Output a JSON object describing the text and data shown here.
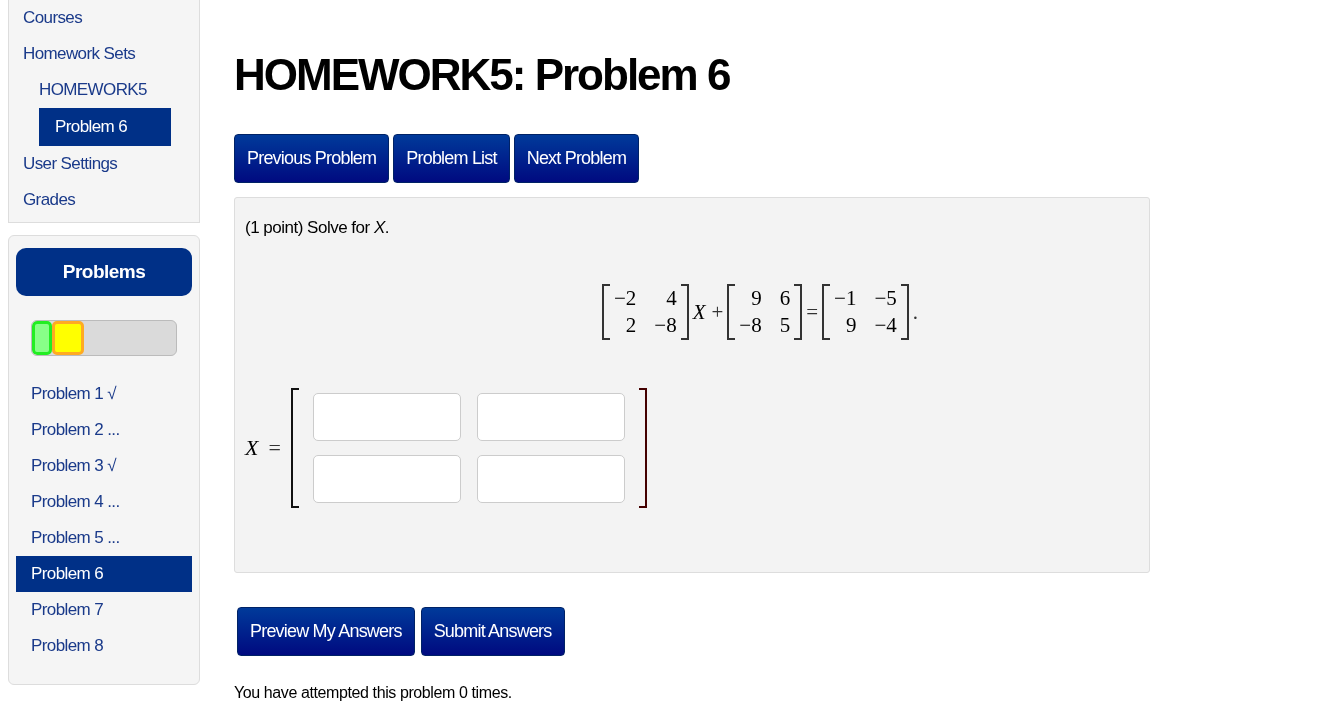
{
  "nav": {
    "items": [
      {
        "label": "Courses",
        "selected": false
      },
      {
        "label": "Homework Sets",
        "selected": false,
        "children": [
          {
            "label": "HOMEWORK5",
            "selected": false,
            "children": [
              {
                "label": "Problem 6",
                "selected": true
              }
            ]
          }
        ]
      },
      {
        "label": "User Settings",
        "selected": false
      },
      {
        "label": "Grades",
        "selected": false
      }
    ]
  },
  "problems_panel": {
    "title": "Problems",
    "progress": [
      {
        "color": "#88ff88",
        "level": 0.14
      },
      {
        "color": "#ffff00",
        "level": 0.22
      }
    ],
    "items": [
      {
        "label": "Problem 1 √",
        "selected": false
      },
      {
        "label": "Problem 2 ...",
        "selected": false
      },
      {
        "label": "Problem 3 √",
        "selected": false
      },
      {
        "label": "Problem 4 ...",
        "selected": false
      },
      {
        "label": "Problem 5 ...",
        "selected": false
      },
      {
        "label": "Problem 6",
        "selected": true
      },
      {
        "label": "Problem 7",
        "selected": false
      },
      {
        "label": "Problem 8",
        "selected": false
      }
    ]
  },
  "title": "HOMEWORK5: Problem 6",
  "nav_buttons": [
    "Previous Problem",
    "Problem List",
    "Next Problem"
  ],
  "problem": {
    "prompt": "(1 point) Solve for *X*.",
    "equation": [
      {
        "kind": "matrix",
        "rows": [
          [
            "−2",
            "4"
          ],
          [
            "2",
            "−8"
          ]
        ]
      },
      {
        "kind": "symbol",
        "text": "X"
      },
      {
        "kind": "operator",
        "text": "+"
      },
      {
        "kind": "matrix",
        "rows": [
          [
            "9",
            "6"
          ],
          [
            "−8",
            "5"
          ]
        ]
      },
      {
        "kind": "operator",
        "text": "="
      },
      {
        "kind": "matrix",
        "rows": [
          [
            "−1",
            "−5"
          ],
          [
            "9",
            "−4"
          ]
        ]
      },
      {
        "kind": "operator",
        "text": "."
      }
    ],
    "answer": {
      "variable": "X",
      "operator": "=",
      "rows": [
        {
          "cells": [
            {
              "kind": "input"
            },
            {
              "kind": "input"
            }
          ]
        },
        {
          "cells": [
            {
              "kind": "input"
            },
            {
              "kind": "input"
            }
          ]
        }
      ]
    }
  },
  "action_buttons": [
    "Preview My Answers",
    "Submit Answers"
  ],
  "attempts": "You have attempted this problem 0 times."
}
